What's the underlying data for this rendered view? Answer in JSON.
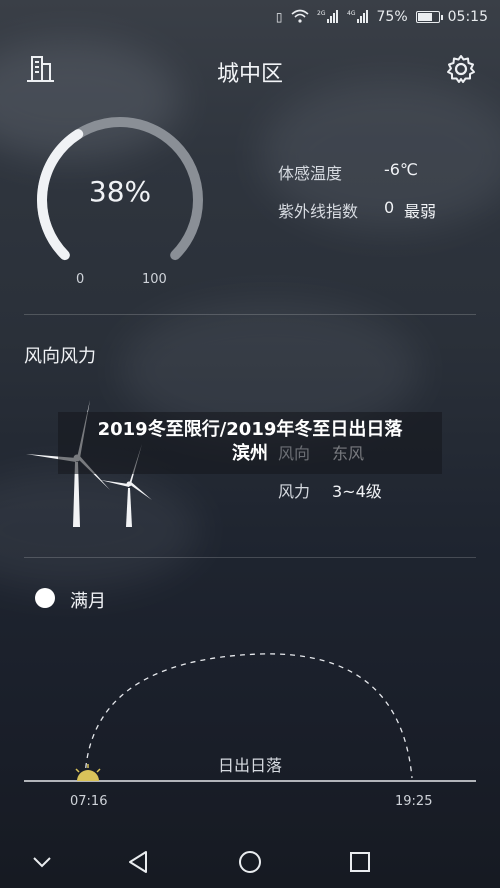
{
  "status_bar": {
    "battery_percent": "75%",
    "time": "05:15",
    "network_2g": "2G",
    "network_4g": "4G",
    "battery_level": 0.75
  },
  "header": {
    "city": "城中区"
  },
  "gauge": {
    "value_text": "38%",
    "min": "0",
    "max": "100",
    "level": 0.38
  },
  "details": {
    "feels_like_label": "体感温度",
    "feels_like_value": "-6℃",
    "uv_label": "紫外线指数",
    "uv_value": "0",
    "uv_level": "最弱"
  },
  "wind": {
    "section_title": "风向风力",
    "direction_label": "风向",
    "direction_value": "东风",
    "force_label": "风力",
    "force_value": "3~4级"
  },
  "overlay": {
    "line1": "2019冬至限行/2019年冬至日出日落",
    "line2": "滨州"
  },
  "moon": {
    "phase": "满月"
  },
  "sun": {
    "label": "日出日落",
    "sunrise": "07:16",
    "sunset": "19:25"
  },
  "colors": {
    "gauge_track": "#8a8f96",
    "gauge_fill": "#f0f2f5",
    "sun": "#d9c35a"
  },
  "icons": {
    "header_left": "building-icon",
    "header_right": "gear-icon",
    "nav_back": "triangle-back-icon",
    "nav_home": "circle-home-icon",
    "nav_recent": "square-recent-icon",
    "nav_down": "chevron-down-icon"
  }
}
